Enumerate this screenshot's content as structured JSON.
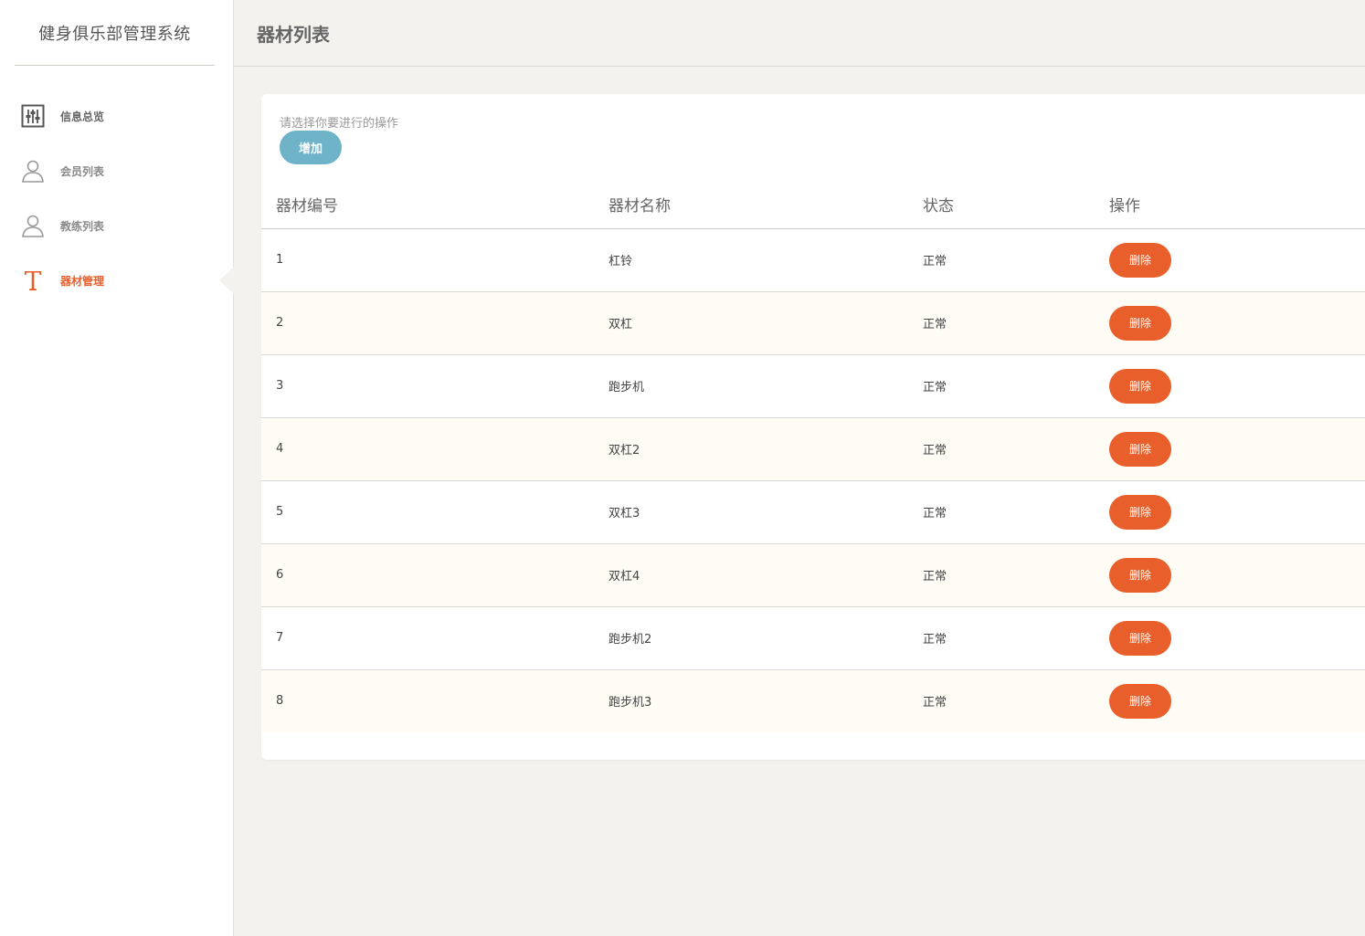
{
  "app": {
    "title": "健身俱乐部管理系统"
  },
  "sidebar": {
    "items": [
      {
        "label": "信息总览",
        "icon": "sliders-icon"
      },
      {
        "label": "会员列表",
        "icon": "user-icon"
      },
      {
        "label": "教练列表",
        "icon": "user-icon"
      },
      {
        "label": "器材管理",
        "icon": "text-t-icon",
        "active": true
      }
    ]
  },
  "header": {
    "title": "器材列表"
  },
  "main": {
    "hint": "请选择你要进行的操作",
    "add_label": "增加",
    "columns": [
      "器材编号",
      "器材名称",
      "状态",
      "操作"
    ],
    "delete_label": "删除",
    "rows": [
      {
        "id": "1",
        "name": "杠铃",
        "status": "正常"
      },
      {
        "id": "2",
        "name": "双杠",
        "status": "正常"
      },
      {
        "id": "3",
        "name": "跑步机",
        "status": "正常"
      },
      {
        "id": "4",
        "name": "双杠2",
        "status": "正常"
      },
      {
        "id": "5",
        "name": "双杠3",
        "status": "正常"
      },
      {
        "id": "6",
        "name": "双杠4",
        "status": "正常"
      },
      {
        "id": "7",
        "name": "跑步机2",
        "status": "正常"
      },
      {
        "id": "8",
        "name": "跑步机3",
        "status": "正常"
      }
    ]
  },
  "colors": {
    "accent": "#e95f2b",
    "add_button": "#6fb3c9",
    "background": "#f3f2ee",
    "row_alt": "#fffcf5"
  }
}
